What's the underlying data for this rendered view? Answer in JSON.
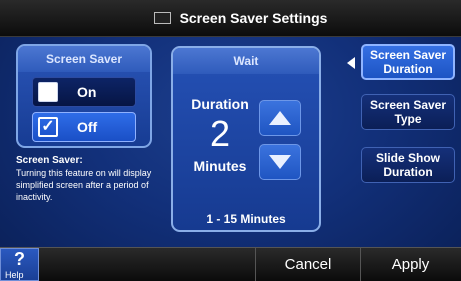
{
  "header": {
    "title": "Screen Saver Settings",
    "icon_text": ""
  },
  "screen_saver": {
    "title": "Screen Saver",
    "on_label": "On",
    "off_label": "Off",
    "selected": "Off",
    "off_check": "✓"
  },
  "info": {
    "title": "Screen Saver:",
    "text": "Turning this feature on will display simplified screen after a period of inactivity."
  },
  "wait": {
    "title": "Wait",
    "duration_label": "Duration",
    "value": "2",
    "unit": "Minutes",
    "range": "1 - 15 Minutes"
  },
  "side_nav": [
    {
      "label": "Screen Saver Duration",
      "active": true
    },
    {
      "label": "Screen Saver Type",
      "active": false
    },
    {
      "label": "Slide Show Duration",
      "active": false
    }
  ],
  "footer": {
    "help_symbol": "?",
    "help_label": "Help",
    "cancel_label": "Cancel",
    "apply_label": "Apply"
  }
}
